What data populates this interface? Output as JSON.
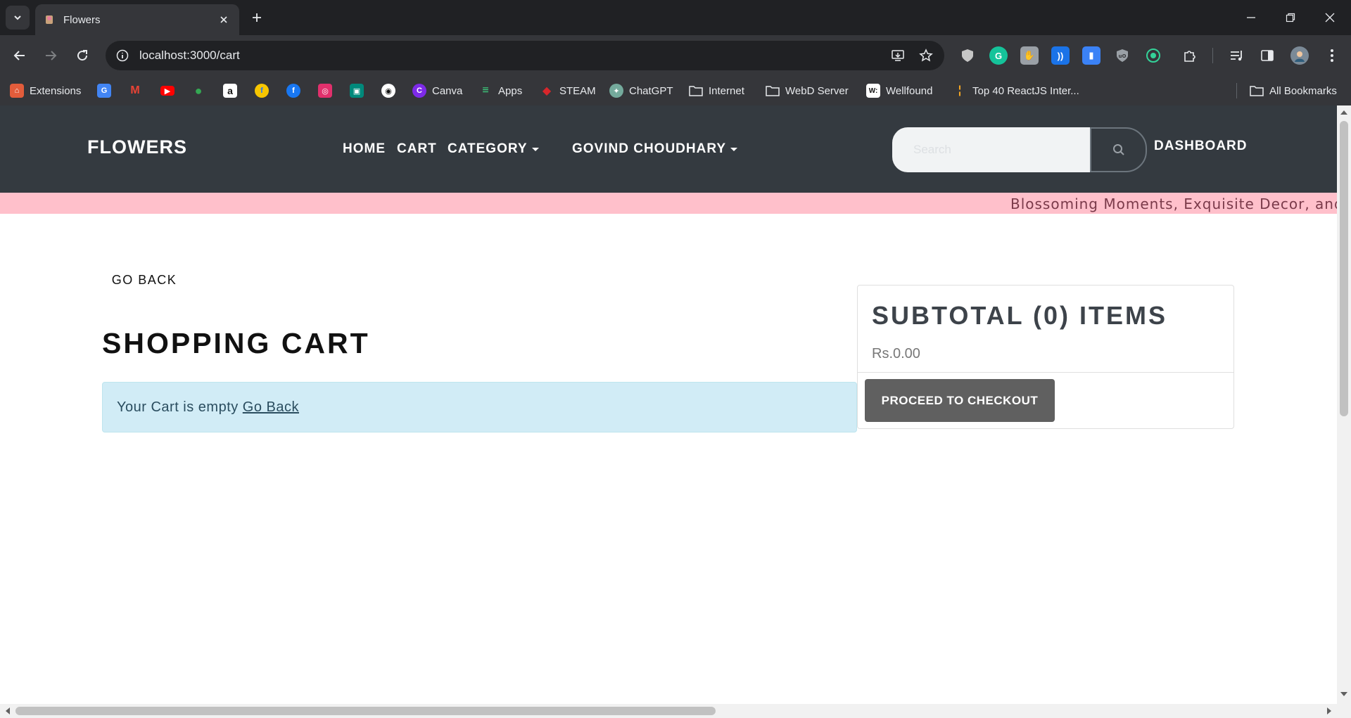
{
  "browser": {
    "tab_title": "Flowers",
    "url": "localhost:3000/cart",
    "bookmarks": [
      {
        "label": "Extensions",
        "icon": "extensions-icon",
        "color": "#e25c3b"
      },
      {
        "label": "",
        "icon": "google-translate-icon",
        "color": "#4285f4"
      },
      {
        "label": "",
        "icon": "gmail-icon",
        "color": "#ea4335"
      },
      {
        "label": "",
        "icon": "youtube-icon",
        "color": "#ff0000"
      },
      {
        "label": "",
        "icon": "maps-icon",
        "color": "#34a853"
      },
      {
        "label": "",
        "icon": "amazon-icon",
        "color": "#ffffff"
      },
      {
        "label": "",
        "icon": "flipkart-icon",
        "color": "#f7c600"
      },
      {
        "label": "",
        "icon": "facebook-icon",
        "color": "#1877f2"
      },
      {
        "label": "",
        "icon": "instagram-icon",
        "color": "#e1306c"
      },
      {
        "label": "",
        "icon": "google-meet-icon",
        "color": "#00897b"
      },
      {
        "label": "",
        "icon": "github-icon",
        "color": "#ffffff"
      },
      {
        "label": "Canva",
        "icon": "canva-icon",
        "color": "#7d2ae8"
      },
      {
        "label": "Apps",
        "icon": "apps-icon",
        "color": "#3ddc84"
      },
      {
        "label": "STEAM",
        "icon": "steam-icon",
        "color": "#d7262b"
      },
      {
        "label": "ChatGPT",
        "icon": "chatgpt-icon",
        "color": "#74aa9c"
      },
      {
        "label": "Internet",
        "icon": "folder-icon",
        "color": "#e8eaed"
      },
      {
        "label": "WebD Server",
        "icon": "folder-icon",
        "color": "#e8eaed"
      },
      {
        "label": "Wellfound",
        "icon": "wellfound-icon",
        "color": "#ffffff"
      },
      {
        "label": "Top 40 ReactJS Inter...",
        "icon": "bookmark-page-icon",
        "color": "#f5a623"
      }
    ],
    "all_bookmarks": "All Bookmarks"
  },
  "site": {
    "brand": "FLOWERS",
    "nav": {
      "home": "HOME",
      "cart": "CART",
      "category": "CATEGORY",
      "user": "GOVIND CHOUDHARY",
      "dashboard": "DASHBOARD"
    },
    "search": {
      "placeholder": "Search"
    },
    "marquee": "Blossoming Moments, Exquisite Decor, and Gif"
  },
  "cart": {
    "go_back": "GO BACK",
    "title": "SHOPPING CART",
    "empty_message": "Your Cart is empty",
    "empty_link": "Go Back"
  },
  "summary": {
    "title": "SUBTOTAL (0) ITEMS",
    "price": "Rs.0.00",
    "checkout": "PROCEED TO CHECKOUT"
  }
}
